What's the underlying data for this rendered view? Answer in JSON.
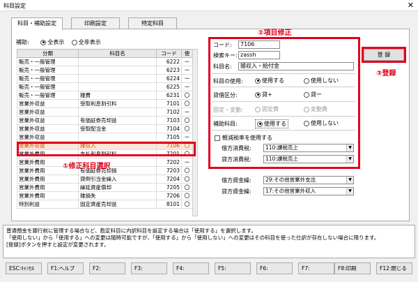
{
  "window": {
    "title": "科目設定",
    "close": "✕"
  },
  "tabs": [
    "科目・補助設定",
    "印刷設定",
    "特定科目"
  ],
  "hojo": {
    "label": "補助:",
    "opt1": "全表示",
    "opt2": "全非表示"
  },
  "grid": {
    "headers": [
      "分類",
      "科目名",
      "コード",
      "使"
    ],
    "rows": [
      [
        "販売・一般管理",
        "",
        "6222",
        "ー"
      ],
      [
        "販売・一般管理",
        "",
        "6223",
        "ー"
      ],
      [
        "販売・一般管理",
        "",
        "6224",
        "ー"
      ],
      [
        "販売・一般管理",
        "",
        "6225",
        "ー"
      ],
      [
        "販売・一般管理",
        "雑費",
        "6231",
        "〇"
      ],
      [
        "営業外収益",
        "受取利息割引料",
        "7101",
        "〇"
      ],
      [
        "営業外収益",
        "",
        "7102",
        "ー"
      ],
      [
        "営業外収益",
        "有価証券売却益",
        "7103",
        "〇"
      ],
      [
        "営業外収益",
        "受取配当金",
        "7104",
        "〇"
      ],
      [
        "営業外収益",
        "",
        "7105",
        "ー"
      ],
      [
        "営業外収益",
        "雑収入",
        "7106",
        "〇"
      ],
      [
        "営業外費用",
        "支払利息割引料",
        "7201",
        "〇"
      ],
      [
        "営業外費用",
        "",
        "7202",
        "ー"
      ],
      [
        "営業外費用",
        "有価証券売却損",
        "7203",
        "〇"
      ],
      [
        "営業外費用",
        "貸倒引当金繰入",
        "7204",
        "〇"
      ],
      [
        "営業外費用",
        "繰延資産償却",
        "7205",
        "〇"
      ],
      [
        "営業外費用",
        "雑損失",
        "7206",
        "〇"
      ],
      [
        "特別利益",
        "固定資産売却益",
        "8101",
        "〇"
      ]
    ],
    "selected_index": 10
  },
  "annotations": {
    "a1": "①修正科目選択",
    "a2": "②項目修正",
    "a3": "③登録"
  },
  "form": {
    "code_label": "コード:",
    "code_value": "7106",
    "search_label": "検索キー:",
    "search_value": "zassh",
    "name_label": "科目名:",
    "name_value": "雑収入・給付金",
    "use_label": "科目の使用:",
    "use_opt1": "使用する",
    "use_opt2": "使用しない",
    "taishaku_label": "貸借区分:",
    "taishaku_opt1": "貸+",
    "taishaku_opt2": "貸ー",
    "kotei_label": "固定・変動:",
    "kotei_opt1": "固定費",
    "kotei_opt2": "変動費",
    "hojo_label": "補助科目:",
    "hojo_opt1": "使用する",
    "hojo_opt2": "使用しない",
    "keigen_label": "軽減税率を使用する",
    "karikata_tax_label": "借方消費税:",
    "karikata_tax_value": "110:課税売上",
    "kashikata_tax_label": "貸方消費税:",
    "kashikata_tax_value": "110:課税売上",
    "karikata_fund_label": "借方資金繰:",
    "karikata_fund_value": "29:その他営業外支出",
    "kashikata_fund_label": "貸方資金繰:",
    "kashikata_fund_value": "17:その他営業外収入"
  },
  "register_button": "登 録",
  "description": [
    "普通預金を銀行前に管理する場合など、勘定科目に内訳科目を設定する場合は「使用する」を選択します。",
    "「使用しない」から「使用する」への変更は随時可能ですが、「使用する」から「使用しない」への変更はその科目を使った仕訳が存在しない場合に限ります。",
    "[登録]ボタンを押すと設定が変更されます。"
  ],
  "fkeys": [
    "ESC:ｷｬﾝｾﾙ",
    "F1:ヘルプ",
    "F2:",
    "F3:",
    "F4:",
    "F5:",
    "F6:",
    "F7:",
    "F8:印刷",
    "F12:閉じる"
  ]
}
